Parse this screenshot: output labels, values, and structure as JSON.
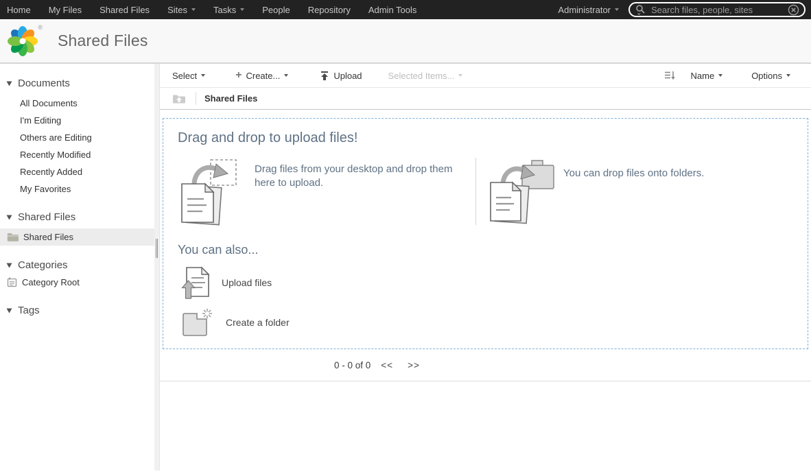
{
  "topnav": {
    "items": [
      {
        "label": "Home",
        "caret": false
      },
      {
        "label": "My Files",
        "caret": false
      },
      {
        "label": "Shared Files",
        "caret": false
      },
      {
        "label": "Sites",
        "caret": true
      },
      {
        "label": "Tasks",
        "caret": true
      },
      {
        "label": "People",
        "caret": false
      },
      {
        "label": "Repository",
        "caret": false
      },
      {
        "label": "Admin Tools",
        "caret": false
      }
    ],
    "user_menu": "Administrator",
    "search_placeholder": "Search files, people, sites"
  },
  "header": {
    "title": "Shared Files",
    "registered_mark": "®"
  },
  "sidebar": {
    "documents": {
      "title": "Documents",
      "items": [
        "All Documents",
        "I'm Editing",
        "Others are Editing",
        "Recently Modified",
        "Recently Added",
        "My Favorites"
      ]
    },
    "shared_files": {
      "title": "Shared Files",
      "selected_item": "Shared Files"
    },
    "categories": {
      "title": "Categories",
      "root_item": "Category Root"
    },
    "tags": {
      "title": "Tags"
    }
  },
  "toolbar": {
    "select_label": "Select",
    "create_label": "Create...",
    "upload_label": "Upload",
    "selected_items_label": "Selected Items...",
    "sort_label": "Name",
    "options_label": "Options"
  },
  "breadcrumb": {
    "current": "Shared Files"
  },
  "dropzone": {
    "title": "Drag and drop to upload files!",
    "drag_hint": "Drag files from your desktop and drop them here to upload.",
    "folder_hint": "You can drop files onto folders.",
    "also_title": "You can also...",
    "upload_files_label": "Upload files",
    "create_folder_label": "Create a folder"
  },
  "paginator": {
    "range": "0 - 0 of 0",
    "prev": "<<",
    "next": ">>"
  },
  "colors": {
    "topbar_bg": "#222222",
    "dropzone_border": "#7fb0d8",
    "muted_heading": "#5f7285",
    "selected_item_bg": "#ececec"
  }
}
